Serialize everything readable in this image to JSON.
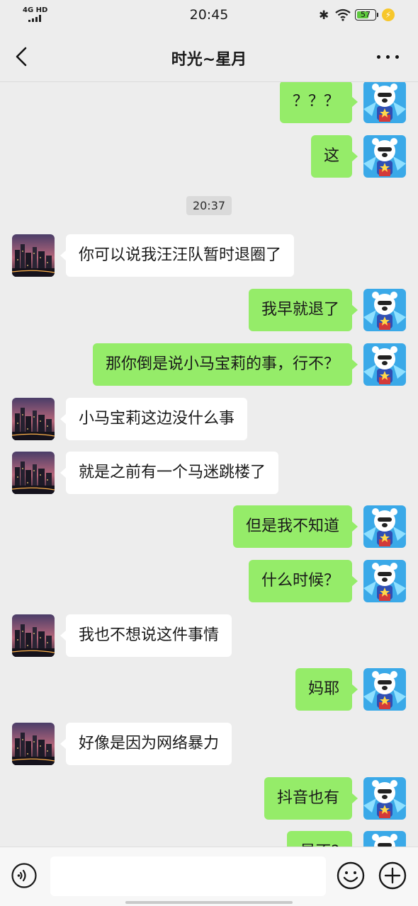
{
  "status_bar": {
    "network": "4G HD",
    "time": "20:45",
    "battery": "57"
  },
  "header": {
    "title": "时光~星月"
  },
  "chat": {
    "timestamp": "20:37",
    "messages": [
      {
        "from": "me",
        "text": "？？？"
      },
      {
        "from": "me",
        "text": "这"
      },
      {
        "from": "them",
        "text": "你可以说我汪汪队暂时退圈了"
      },
      {
        "from": "me",
        "text": "我早就退了"
      },
      {
        "from": "me",
        "text": "那你倒是说小马宝莉的事，行不？"
      },
      {
        "from": "them",
        "text": "小马宝莉这边没什么事"
      },
      {
        "from": "them",
        "text": "就是之前有一个马迷跳楼了"
      },
      {
        "from": "me",
        "text": "但是我不知道"
      },
      {
        "from": "me",
        "text": "什么时候？"
      },
      {
        "from": "them",
        "text": "我也不想说这件事情"
      },
      {
        "from": "me",
        "text": "妈耶"
      },
      {
        "from": "them",
        "text": "好像是因为网络暴力"
      },
      {
        "from": "me",
        "text": "抖音也有"
      },
      {
        "from": "me",
        "text": "是不?"
      }
    ]
  },
  "input": {
    "value": "",
    "placeholder": ""
  },
  "colors": {
    "my_bubble": "#95ec69",
    "their_bubble": "#ffffff",
    "background": "#ededed"
  }
}
